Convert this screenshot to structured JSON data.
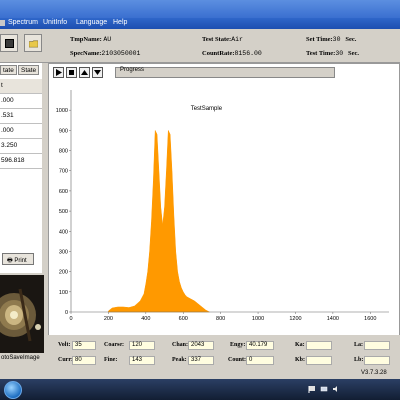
{
  "menu": {
    "items": [
      "Spectrum",
      "UnitInfo",
      "Language",
      "Help"
    ]
  },
  "info": {
    "tmp_name_label": "TmpName:",
    "tmp_name_value": "AU",
    "spec_name_label": "SpecName:",
    "spec_name_value": "2103050001",
    "test_state_label": "Test State:",
    "test_state_value": "Air",
    "count_rate_label": "CountRate:",
    "count_rate_value": "8156.00",
    "set_time_label": "Set Time:",
    "set_time_value": "30",
    "set_time_unit": "Sec.",
    "test_time_label": "Test Time:",
    "test_time_value": "30",
    "test_time_unit": "Sec."
  },
  "left": {
    "tabs": [
      "tate",
      "State"
    ],
    "rows": [
      "t",
      ".000",
      ".531",
      ".000",
      "3.250",
      "596.818"
    ],
    "print_label": "Print",
    "camera_caption": "otoSaveImage"
  },
  "graph": {
    "progress_label": "Progress",
    "controls": [
      "play",
      "stop",
      "up",
      "down"
    ]
  },
  "chart_data": {
    "type": "area",
    "title": "TestSample",
    "xlabel": "",
    "ylabel": "",
    "xlim": [
      0,
      1700
    ],
    "ylim": [
      0,
      1100
    ],
    "xticks": [
      0,
      200,
      400,
      600,
      800,
      1000,
      1200,
      1400,
      1600
    ],
    "yticks": [
      0,
      100,
      200,
      300,
      400,
      500,
      600,
      700,
      800,
      900,
      1000
    ],
    "color": "#ff9900",
    "x": [
      200,
      220,
      250,
      280,
      310,
      340,
      370,
      390,
      400,
      410,
      420,
      430,
      440,
      450,
      460,
      470,
      480,
      490,
      500,
      510,
      520,
      530,
      540,
      550,
      560,
      570,
      580,
      590,
      600,
      610,
      620,
      640,
      660,
      680,
      700,
      720,
      740
    ],
    "values": [
      5,
      20,
      25,
      25,
      22,
      30,
      55,
      90,
      140,
      200,
      300,
      450,
      650,
      900,
      880,
      700,
      520,
      430,
      520,
      700,
      900,
      880,
      700,
      480,
      300,
      200,
      150,
      120,
      100,
      85,
      75,
      65,
      55,
      40,
      25,
      10,
      0
    ]
  },
  "bottom": {
    "volt_label": "Volt:",
    "volt_value": "35",
    "curr_label": "Curr:",
    "curr_value": "80",
    "coarse_label": "Coarse:",
    "coarse_value": "120",
    "fine_label": "Fine:",
    "fine_value": "143",
    "chan_label": "Chan:",
    "chan_value": "2043",
    "peak_label": "Peak:",
    "peak_value": "337",
    "engy_label": "Engy:",
    "engy_value": "40.179",
    "count_label": "Count:",
    "count_value": "0",
    "ka_label": "Ka:",
    "kb_label": "Kb:",
    "la_label": "La:",
    "lb_label": "Lb:",
    "version": "V3.7.3.28"
  }
}
